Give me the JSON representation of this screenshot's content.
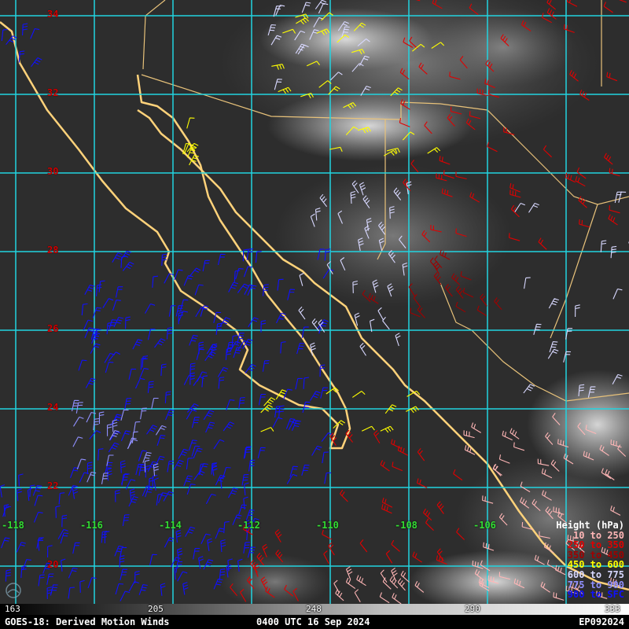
{
  "footer": {
    "satellite_product": "GOES-18: Derived Motion Winds",
    "time": "0400 UTC 16 Sep 2024",
    "storm_id": "EP092024"
  },
  "colorbar": {
    "ticks": [
      "163",
      "205",
      "248",
      "290",
      "333"
    ]
  },
  "latitudes": [
    "34",
    "32",
    "30",
    "28",
    "26",
    "24",
    "22",
    "20"
  ],
  "longitudes": [
    "-118",
    "-116",
    "-114",
    "-112",
    "-110",
    "-108",
    "-106"
  ],
  "legend": {
    "title": "Height (hPa)",
    "entries": [
      {
        "label": "10 to 250",
        "color": "#ffb6b6"
      },
      {
        "label": "250 to 350",
        "color": "#e00000"
      },
      {
        "label": "350 to 450",
        "color": "#a00000"
      },
      {
        "label": "450 to 600",
        "color": "#ffff00"
      },
      {
        "label": "600 to 775",
        "color": "#d8d8ff"
      },
      {
        "label": "775 to 900",
        "color": "#9090ff"
      },
      {
        "label": "900 to SFC",
        "color": "#1010ff"
      }
    ]
  },
  "colors": {
    "grid": "#22d3e0",
    "coast": "#ffd27a",
    "background": "#2a2a2a"
  }
}
